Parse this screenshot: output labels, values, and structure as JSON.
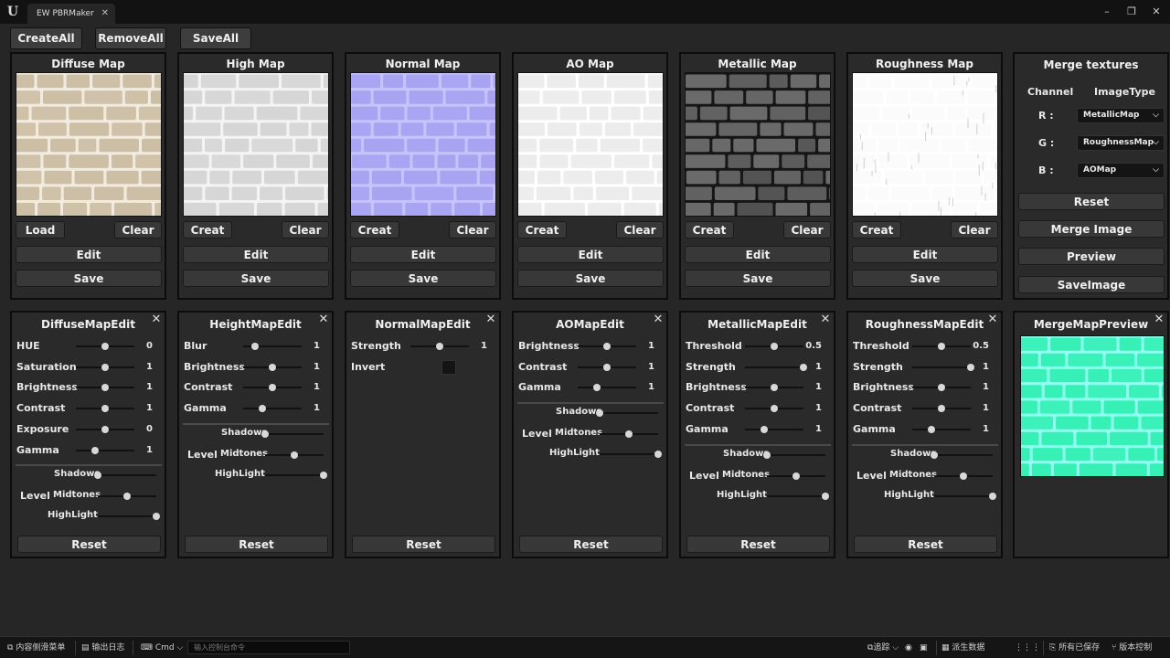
{
  "window": {
    "tab_title": "EW PBRMaker",
    "logo": "U"
  },
  "toolbar": {
    "create_all": "CreateAll",
    "remove_all": "RemoveAll",
    "save_all": "SaveAll"
  },
  "maps": [
    {
      "title": "Diffuse Map",
      "left_btn": "Load",
      "clear": "Clear",
      "edit": "Edit",
      "save": "Save"
    },
    {
      "title": "High Map",
      "left_btn": "Creat",
      "clear": "Clear",
      "edit": "Edit",
      "save": "Save"
    },
    {
      "title": "Normal Map",
      "left_btn": "Creat",
      "clear": "Clear",
      "edit": "Edit",
      "save": "Save"
    },
    {
      "title": "AO Map",
      "left_btn": "Creat",
      "clear": "Clear",
      "edit": "Edit",
      "save": "Save"
    },
    {
      "title": "Metallic Map",
      "left_btn": "Creat",
      "clear": "Clear",
      "edit": "Edit",
      "save": "Save"
    },
    {
      "title": "Roughness Map",
      "left_btn": "Creat",
      "clear": "Clear",
      "edit": "Edit",
      "save": "Save"
    }
  ],
  "merge": {
    "title": "Merge textures",
    "channel_header": "Channel",
    "type_header": "ImageType",
    "channels": [
      {
        "label": "R :",
        "value": "MetallicMap"
      },
      {
        "label": "G :",
        "value": "RoughnessMap"
      },
      {
        "label": "B :",
        "value": "AOMap"
      }
    ],
    "reset": "Reset",
    "merge_image": "Merge Image",
    "preview": "Preview",
    "save_image": "SaveImage"
  },
  "edits": [
    {
      "title": "DiffuseMapEdit",
      "reset": "Reset",
      "params": [
        {
          "label": "HUE",
          "value": "0",
          "pos": 0.5
        },
        {
          "label": "Saturation",
          "value": "1",
          "pos": 0.5
        },
        {
          "label": "Brightness",
          "value": "1",
          "pos": 0.5
        },
        {
          "label": "Contrast",
          "value": "1",
          "pos": 0.5
        },
        {
          "label": "Exposure",
          "value": "0",
          "pos": 0.5
        },
        {
          "label": "Gamma",
          "value": "1",
          "pos": 0.33
        }
      ],
      "level": {
        "word": "Level",
        "shadows": "Shadows",
        "midtones": "Midtones",
        "highlight": "HighLight",
        "shadows_pos": 0.0,
        "midtones_pos": 0.5,
        "highlight_pos": 1.0
      }
    },
    {
      "title": "HeightMapEdit",
      "reset": "Reset",
      "params": [
        {
          "label": "Blur",
          "value": "1",
          "pos": 0.2
        },
        {
          "label": "Brightness",
          "value": "1",
          "pos": 0.5
        },
        {
          "label": "Contrast",
          "value": "1",
          "pos": 0.5
        },
        {
          "label": "Gamma",
          "value": "1",
          "pos": 0.33
        }
      ],
      "level": {
        "word": "Level",
        "shadows": "Shadows",
        "midtones": "Midtones",
        "highlight": "HighLight",
        "shadows_pos": 0.0,
        "midtones_pos": 0.5,
        "highlight_pos": 1.0
      }
    },
    {
      "title": "NormalMapEdit",
      "reset": "Reset",
      "params": [
        {
          "label": "Strength",
          "value": "1",
          "pos": 0.5
        }
      ],
      "invert": "Invert"
    },
    {
      "title": "AOMapEdit",
      "reset": "Reset",
      "params": [
        {
          "label": "Brightness",
          "value": "1",
          "pos": 0.5
        },
        {
          "label": "Contrast",
          "value": "1",
          "pos": 0.5
        },
        {
          "label": "Gamma",
          "value": "1",
          "pos": 0.33
        }
      ],
      "level": {
        "word": "Level",
        "shadows": "Shadows",
        "midtones": "Midtones",
        "highlight": "HighLight",
        "shadows_pos": 0.0,
        "midtones_pos": 0.5,
        "highlight_pos": 1.0
      }
    },
    {
      "title": "MetallicMapEdit",
      "reset": "Reset",
      "params": [
        {
          "label": "Threshold",
          "value": "0.5",
          "pos": 0.5
        },
        {
          "label": "Strength",
          "value": "1",
          "pos": 1.0
        },
        {
          "label": "Brightness",
          "value": "1",
          "pos": 0.5
        },
        {
          "label": "Contrast",
          "value": "1",
          "pos": 0.5
        },
        {
          "label": "Gamma",
          "value": "1",
          "pos": 0.33
        }
      ],
      "level": {
        "word": "Level",
        "shadows": "Shadows",
        "midtones": "Midtones",
        "highlight": "HighLight",
        "shadows_pos": 0.0,
        "midtones_pos": 0.5,
        "highlight_pos": 1.0
      }
    },
    {
      "title": "RoughnessMapEdit",
      "reset": "Reset",
      "params": [
        {
          "label": "Threshold",
          "value": "0.5",
          "pos": 0.5
        },
        {
          "label": "Strength",
          "value": "1",
          "pos": 1.0
        },
        {
          "label": "Brightness",
          "value": "1",
          "pos": 0.5
        },
        {
          "label": "Contrast",
          "value": "1",
          "pos": 0.5
        },
        {
          "label": "Gamma",
          "value": "1",
          "pos": 0.33
        }
      ],
      "level": {
        "word": "Level",
        "shadows": "Shadows",
        "midtones": "Midtones",
        "highlight": "HighLight",
        "shadows_pos": 0.0,
        "midtones_pos": 0.5,
        "highlight_pos": 1.0
      }
    }
  ],
  "merge_preview": {
    "title": "MergeMapPreview"
  },
  "statusbar": {
    "content_drawer": "内容侧滑菜单",
    "output_log": "输出日志",
    "cmd": "Cmd",
    "cmd_placeholder": "输入控制台命令",
    "trace": "追踪",
    "derived_data": "派生数据",
    "all_saved": "所有已保存",
    "source_control": "版本控制"
  },
  "colors": {
    "diffuse": "#cdbfa6",
    "diffuse_mortar": "#f2ece0",
    "height": "#d6d6d6",
    "height_mortar": "#f4f4f4",
    "normal": "#a9a4f2",
    "normal_mortar": "#c7c4fb",
    "ao": "#ececec",
    "ao_mortar": "#ffffff",
    "metallic": "#6a6a6a",
    "metallic_mortar": "#161616",
    "roughness": "#fbfbfb",
    "roughness_mortar": "#ffffff",
    "merged": "#36f0b6",
    "merged_mortar": "#8ffff0"
  }
}
